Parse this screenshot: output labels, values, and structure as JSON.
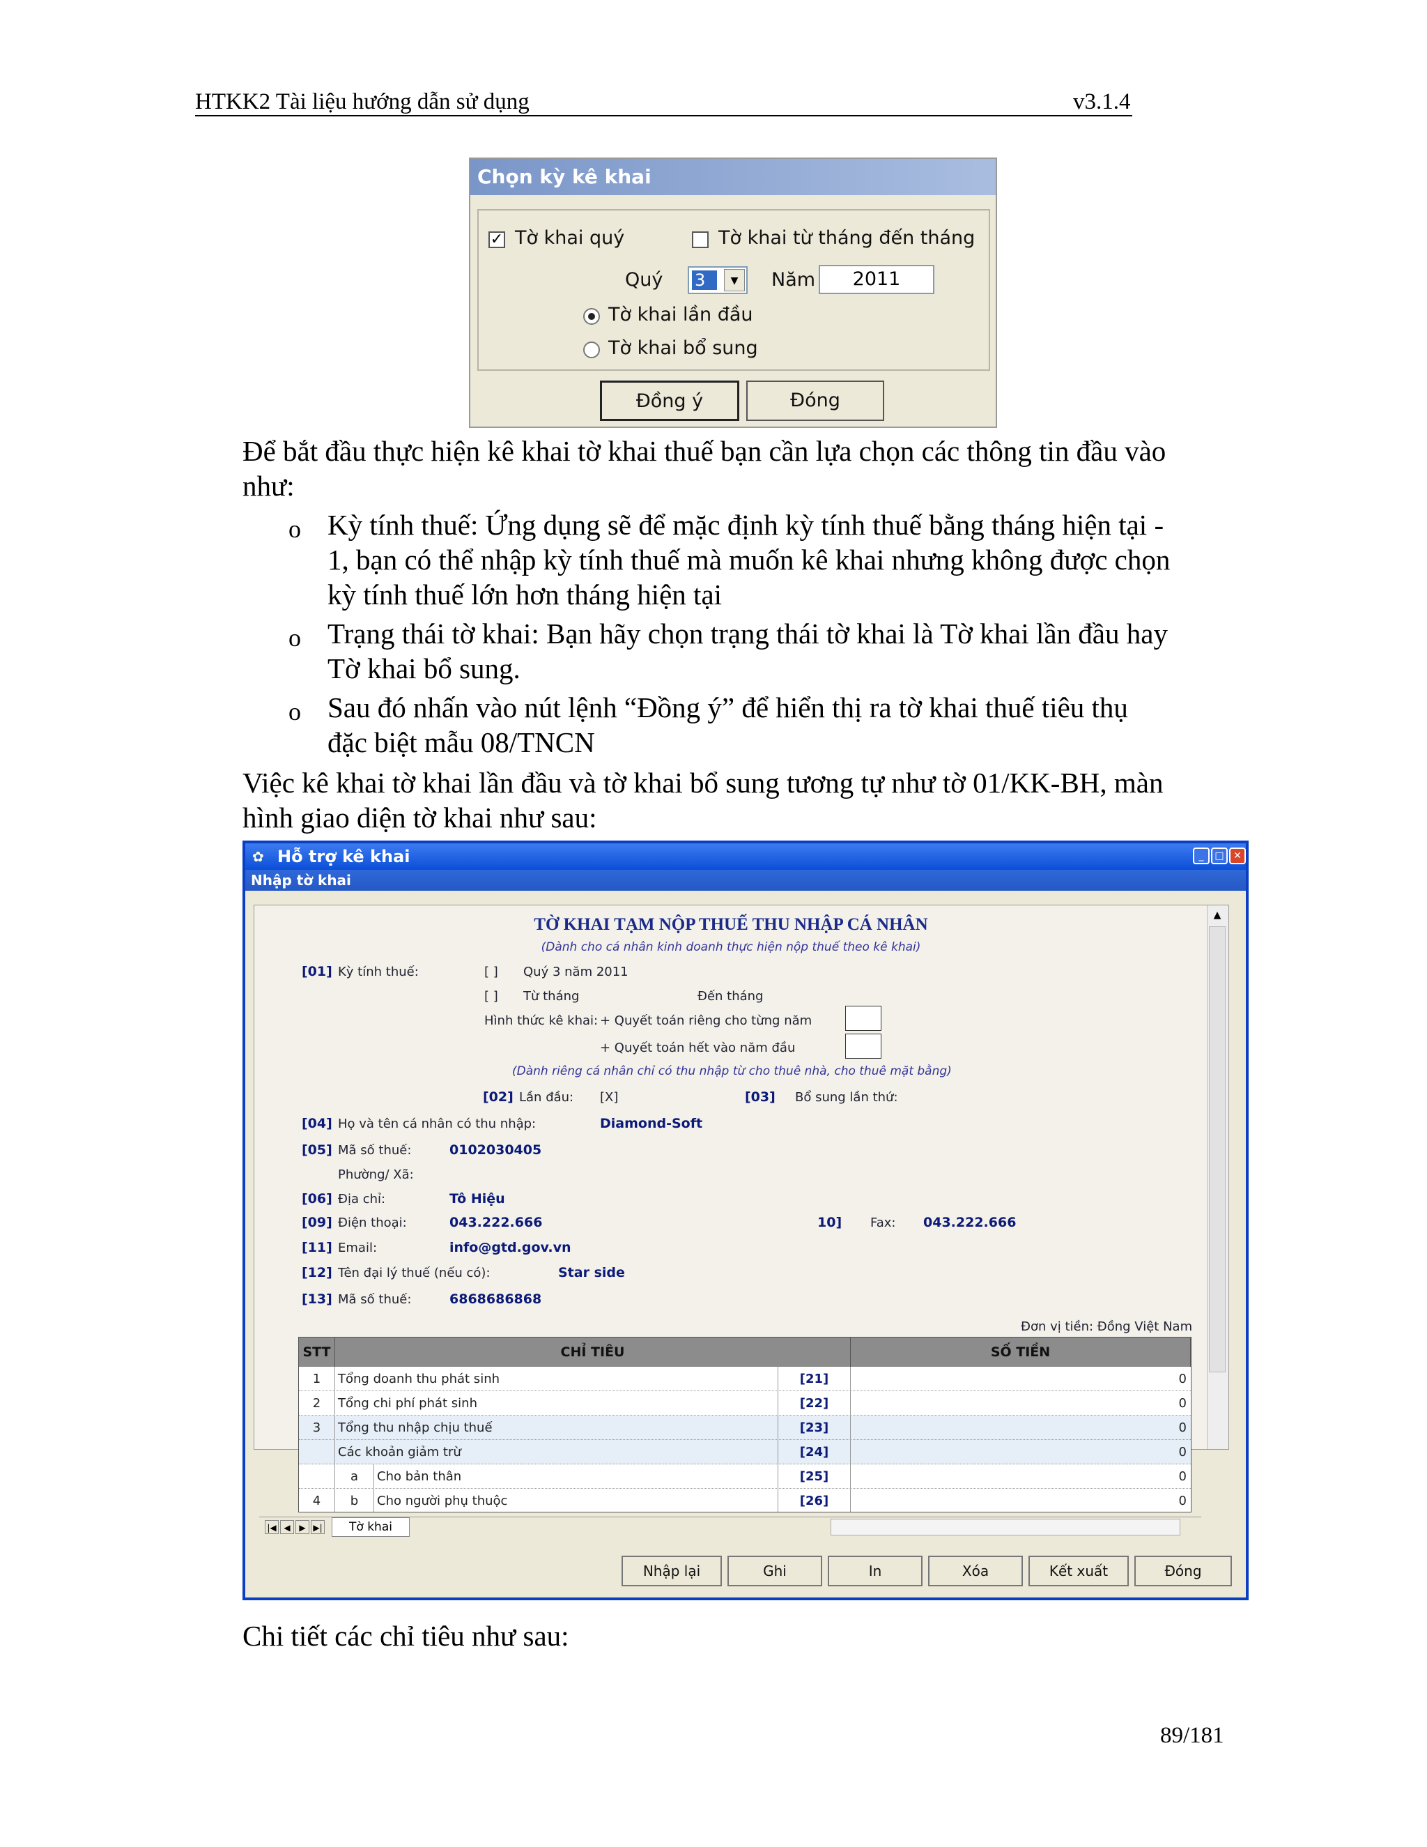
{
  "header": {
    "left": "HTKK2 Tài liệu hướng dẫn sử dụng",
    "right": "v3.1.4"
  },
  "dialog1": {
    "title": "Chọn kỳ kê khai",
    "chk_quarter": "Tờ khai quý",
    "chk_month_range": "Tờ khai từ tháng đến tháng",
    "quarter_label": "Quý",
    "quarter_value": "3",
    "year_label": "Năm",
    "year_value": "2011",
    "radio_first": "Tờ khai lần đầu",
    "radio_supplement": "Tờ khai bổ sung",
    "btn_ok": "Đồng ý",
    "btn_close": "Đóng"
  },
  "body": {
    "intro_1": "Để bắt đầu thực hiện kê khai tờ khai thuế bạn cần lựa chọn các thông tin đầu vào",
    "intro_2": "như:",
    "b1_1": "Kỳ tính thuế: Ứng dụng sẽ để mặc định kỳ tính thuế bằng tháng hiện tại -",
    "b1_2": "1, bạn có thể nhập kỳ tính thuế mà muốn kê khai nhưng không được chọn",
    "b1_3": "kỳ tính thuế lớn hơn tháng hiện tại",
    "b2_1": "Trạng thái tờ khai: Bạn hãy chọn trạng thái tờ khai là Tờ khai lần đầu hay",
    "b2_2": "Tờ khai bổ sung.",
    "b3_1": "Sau đó nhấn vào nút lệnh “Đồng ý” để hiển thị ra tờ khai thuế tiêu thụ",
    "b3_2": "đặc biệt mẫu 08/TNCN",
    "after_1": "Việc kê khai tờ khai lần đầu và tờ khai bổ sung tương tự như tờ 01/KK-BH, màn",
    "after_2": "hình giao diện tờ khai như sau:",
    "outro": "Chi tiết các chỉ tiêu như sau:",
    "bullet_glyph": "o"
  },
  "window": {
    "title": "Hỗ trợ kê khai",
    "subtitle": "Nhập tờ khai",
    "form": {
      "heading": "TỜ KHAI TẠM NỘP THUẾ THU NHẬP CÁ NHÂN",
      "subheading": "(Dành cho cá nhân kinh doanh thực hiện nộp thuế theo kê khai)",
      "c01": "[01]",
      "l01": "Kỳ tính thuế:",
      "br1": "[ ]",
      "period_quarter": "Quý 3 năm 2011",
      "br2": "[ ]",
      "from_month": "Từ tháng",
      "to_month": "Đến tháng",
      "form_label": "Hình thức kê khai:",
      "opt1": "+ Quyết toán riêng cho từng năm",
      "opt2": "+ Quyết toán hết vào năm đầu",
      "rental_note": "(Dành riêng cá nhân chỉ có thu nhập từ cho thuê nhà, cho thuê mặt bằng)",
      "c02": "[02]",
      "l02": "Lần đầu:",
      "v02": "[X]",
      "c03": "[03]",
      "l03": "Bổ sung lần thứ:",
      "c04": "[04]",
      "l04": "Họ và tên cá nhân có thu nhập:",
      "v04": "Diamond-Soft",
      "c05": "[05]",
      "l05": "Mã số thuế:",
      "v05": "0102030405",
      "ward": "Phường/ Xã:",
      "c06": "[06]",
      "l06": "Địa chỉ:",
      "v06": "Tô Hiệu",
      "c09": "[09]",
      "l09": "Điện thoại:",
      "v09": "043.222.666",
      "c10": "10]",
      "l10": "Fax:",
      "v10": "043.222.666",
      "c11": "[11]",
      "l11": "Email:",
      "v11": "info@gtd.gov.vn",
      "c12": "[12]",
      "l12": "Tên đại lý thuế (nếu có):",
      "v12": "Star side",
      "c13": "[13]",
      "l13": "Mã số thuế:",
      "v13": "6868686868",
      "unit": "Đơn vị tiền: Đồng Việt Nam"
    },
    "grid": {
      "headers": [
        "STT",
        "CHỈ TIÊU",
        "SỐ TIỀN"
      ],
      "rows": [
        {
          "stt": "1",
          "sub": "",
          "label": "Tổng doanh thu phát sinh",
          "code": "[21]",
          "amount": "0"
        },
        {
          "stt": "2",
          "sub": "",
          "label": "Tổng chi phí phát sinh",
          "code": "[22]",
          "amount": "0"
        },
        {
          "stt": "3",
          "sub": "",
          "label": "Tổng thu nhập chịu thuế",
          "code": "[23]",
          "amount": "0"
        },
        {
          "stt": "",
          "sub": "",
          "label": "Các khoản giảm trừ",
          "code": "[24]",
          "amount": "0"
        },
        {
          "stt": "",
          "sub": "a",
          "label": "Cho bản thân",
          "code": "[25]",
          "amount": "0"
        },
        {
          "stt": "4",
          "sub": "b",
          "label": "Cho người phụ thuộc",
          "code": "[26]",
          "amount": "0"
        }
      ]
    },
    "sheet_tab": "Tờ khai",
    "buttons": {
      "reset": "Nhập lại",
      "save": "Ghi",
      "print": "In",
      "delete": "Xóa",
      "export": "Kết xuất",
      "close": "Đóng"
    }
  },
  "page_number": "89/181"
}
